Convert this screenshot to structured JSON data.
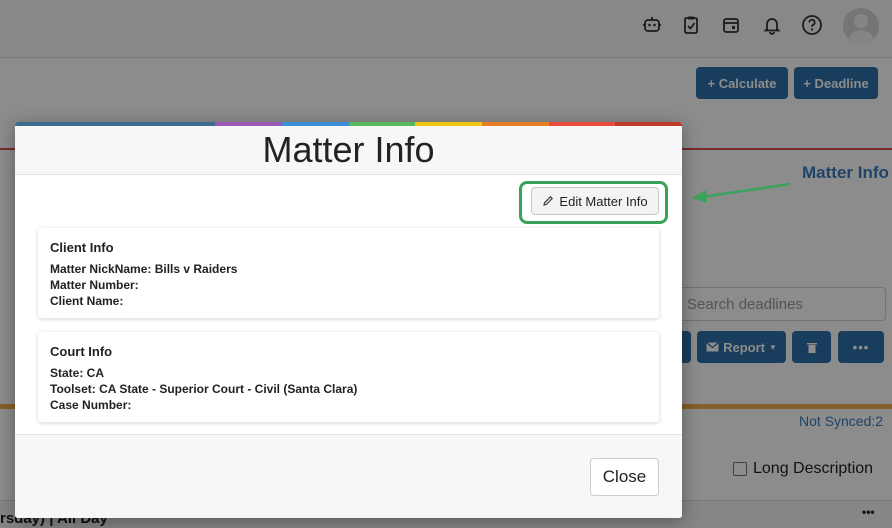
{
  "background": {
    "header_icons": [
      "robot-icon",
      "clipboard-check-icon",
      "calendar-icon",
      "bell-icon",
      "help-icon"
    ],
    "toolbar": {
      "calculate_label": "+ Calculate",
      "deadline_label": "+ Deadline"
    },
    "matter_info_link": "Matter Info",
    "search_placeholder": "Search deadlines",
    "report_label": "Report",
    "not_synced": "Not Synced:2",
    "long_description_label": "Long Description",
    "row_text": "rsday) | All Day"
  },
  "modal": {
    "title": "Matter Info",
    "edit_button_label": "Edit Matter Info",
    "client_info": {
      "title": "Client Info",
      "lines": [
        "Matter NickName: Bills v Raiders",
        "Matter Number:",
        "Client Name:"
      ]
    },
    "court_info": {
      "title": "Court Info",
      "lines": [
        "State: CA",
        "Toolset: CA State - Superior Court - Civil (Santa Clara)",
        "Case Number:"
      ]
    },
    "close_label": "Close",
    "colors": {
      "rainbow": [
        "#3a6e8f",
        "#3a6e8f",
        "#3a6e8f",
        "#9b59b6",
        "#3b8fd9",
        "#5cb85c",
        "#f1c40f",
        "#e67e22",
        "#e74c3c",
        "#c0392b"
      ],
      "highlight": "#3aa35a"
    }
  }
}
